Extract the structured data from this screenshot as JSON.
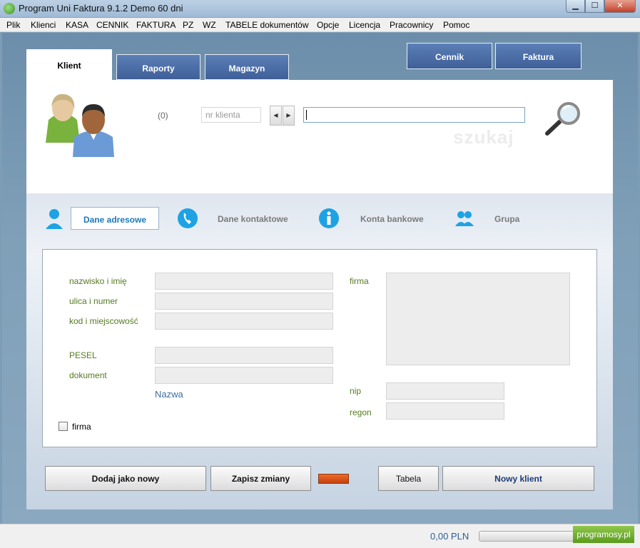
{
  "window": {
    "title": "Program Uni Faktura 9.1.2    Demo 60 dni"
  },
  "menu": [
    "Plik",
    "Klienci",
    "KASA",
    "CENNIK",
    "FAKTURA",
    "PZ",
    "WZ",
    "TABELE dokumentów",
    "Opcje",
    "Licencja",
    "Pracownicy",
    "Pomoc"
  ],
  "tabs": {
    "klient": "Klient",
    "raporty": "Raporty",
    "magazyn": "Magazyn"
  },
  "top_buttons": {
    "cennik": "Cennik",
    "faktura": "Faktura"
  },
  "search": {
    "count": "(0)",
    "nr_placeholder": "nr klienta",
    "value": "",
    "watermark": "szukaj"
  },
  "sections": {
    "adres": "Dane adresowe",
    "kontakt": "Dane kontaktowe",
    "konta": "Konta bankowe",
    "grupa": "Grupa"
  },
  "form": {
    "nazwisko": "nazwisko i imię",
    "ulica": "ulica i numer",
    "kod": "kod i miejscowość",
    "pesel": "PESEL",
    "dokument": "dokument",
    "nazwa": "Nazwa",
    "firma_label": "firma",
    "nip": "nip",
    "regon": "regon",
    "firma_check": "firma"
  },
  "buttons": {
    "dodaj": "Dodaj jako nowy",
    "zapisz": "Zapisz zmiany",
    "tabela": "Tabela",
    "nowy": "Nowy klient"
  },
  "status": {
    "amount": "0,00 PLN",
    "brand": "programosy.pl"
  },
  "colors": {
    "accent_blue": "#3f5f98",
    "label_green": "#547b20",
    "active_tab_text": "#1b78b8",
    "indicator_orange": "#e0571a"
  }
}
